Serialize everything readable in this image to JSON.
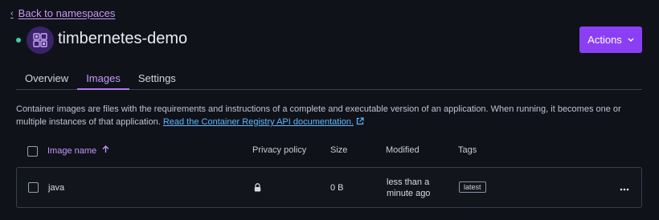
{
  "nav": {
    "back_label": "Back to namespaces"
  },
  "header": {
    "title": "timbernetes-demo",
    "status_color": "#3fcf9b",
    "actions_label": "Actions"
  },
  "tabs": [
    {
      "label": "Overview",
      "active": false
    },
    {
      "label": "Images",
      "active": true
    },
    {
      "label": "Settings",
      "active": false
    }
  ],
  "description": {
    "text": "Container images are files with the requirements and instructions of a complete and executable version of an application. When running, it becomes one or multiple instances of that application. ",
    "link_label": "Read the Container Registry API documentation."
  },
  "table": {
    "columns": {
      "name": "Image name",
      "privacy": "Privacy policy",
      "size": "Size",
      "modified": "Modified",
      "tags": "Tags"
    },
    "sort": {
      "column": "name",
      "direction": "ascending"
    },
    "rows": [
      {
        "name": "java",
        "privacy_icon": "lock-icon",
        "size": "0 B",
        "modified": "less than a minute ago",
        "tag": "latest"
      }
    ]
  },
  "colors": {
    "accent": "#8b3ff5",
    "link": "#5db8ff",
    "background": "#10121a"
  }
}
